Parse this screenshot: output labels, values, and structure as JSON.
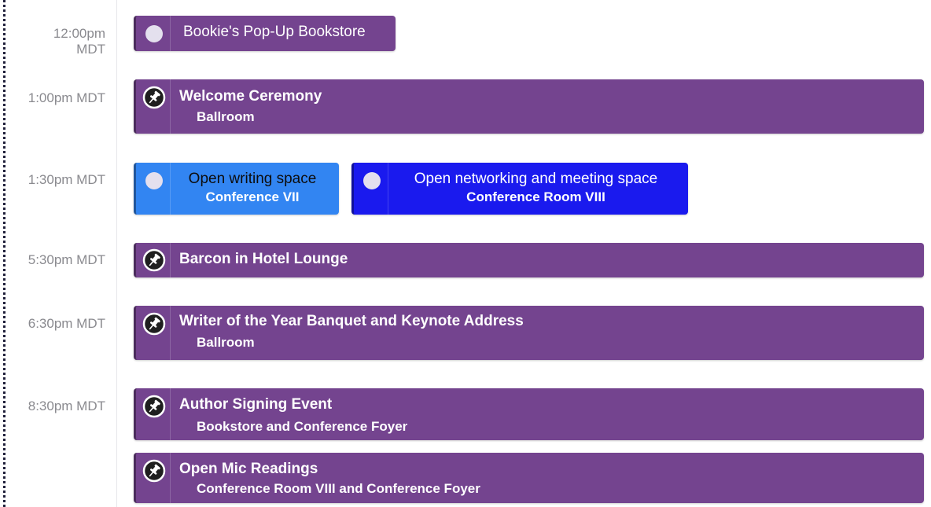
{
  "schedule": {
    "rows": [
      {
        "time": "12:00pm",
        "tz": "MDT"
      },
      {
        "time": "1:00pm MDT"
      },
      {
        "time": "1:30pm MDT"
      },
      {
        "time": "5:30pm MDT"
      },
      {
        "time": "6:30pm MDT"
      },
      {
        "time": "8:30pm MDT"
      }
    ],
    "events": [
      {
        "title": "Bookie's Pop-Up Bookstore",
        "location": "",
        "color": "#74448f",
        "icon": "circle-dot-icon"
      },
      {
        "title": "Welcome Ceremony",
        "location": "Ballroom",
        "color": "#74448f",
        "icon": "pushpin-icon"
      },
      {
        "title": "Open writing space",
        "location": "Conference VII",
        "color": "#3285f2",
        "icon": "circle-dot-icon"
      },
      {
        "title": "Open networking and meeting space",
        "location": "Conference Room VIII",
        "color": "#1a1aee",
        "icon": "circle-dot-icon"
      },
      {
        "title": "Barcon in Hotel Lounge",
        "location": "",
        "color": "#74448f",
        "icon": "pushpin-icon"
      },
      {
        "title": "Writer of the Year Banquet and Keynote Address",
        "location": "Ballroom",
        "color": "#74448f",
        "icon": "pushpin-icon"
      },
      {
        "title": "Author Signing Event",
        "location": "Bookstore and Conference Foyer",
        "color": "#74448f",
        "icon": "pushpin-icon"
      },
      {
        "title": "Open Mic Readings",
        "location": "Conference Room VIII and Conference Foyer",
        "color": "#74448f",
        "icon": "pushpin-icon"
      }
    ]
  }
}
